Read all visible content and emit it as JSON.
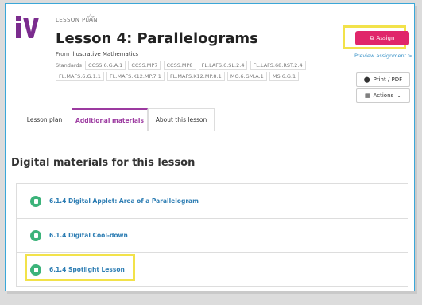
{
  "header": {
    "overline": "LESSON PLAN",
    "star_icon": "star-outline-icon",
    "title": "Lesson 4: Parallelograms",
    "from_label": "From",
    "from_source": "Illustrative Mathematics",
    "standards_label": "Standards",
    "standards": [
      "CCSS.6.G.A.1",
      "CCSS.MP7",
      "CCSS.MP8",
      "FL.LAFS.6.SL.2.4",
      "FL.LAFS.68.RST.2.4",
      "FL.MAFS.6.G.1.1",
      "FL.MAFS.K12.MP.7.1",
      "FL.MAFS.K12.MP.8.1",
      "MO.6.GM.A.1",
      "MS.6.G.1"
    ]
  },
  "actions": {
    "assign_label": "Assign",
    "preview_label": "Preview assignment >",
    "print_label": "Print / PDF",
    "actions_label": "Actions"
  },
  "tabs": [
    {
      "label": "Lesson plan"
    },
    {
      "label": "Additional materials"
    },
    {
      "label": "About this lesson"
    }
  ],
  "section": {
    "title": "Digital materials for this lesson",
    "items": [
      {
        "label": "6.1.4 Digital Applet: Area of a Parallelogram"
      },
      {
        "label": "6.1.4 Digital Cool-down"
      },
      {
        "label": "6.1.4 Spotlight Lesson"
      }
    ]
  },
  "colors": {
    "brand": "#7b2c8e",
    "assign": "#e0266a",
    "link": "#2d7db3",
    "highlight": "#f2e24a",
    "item_icon": "#3cb37a"
  }
}
